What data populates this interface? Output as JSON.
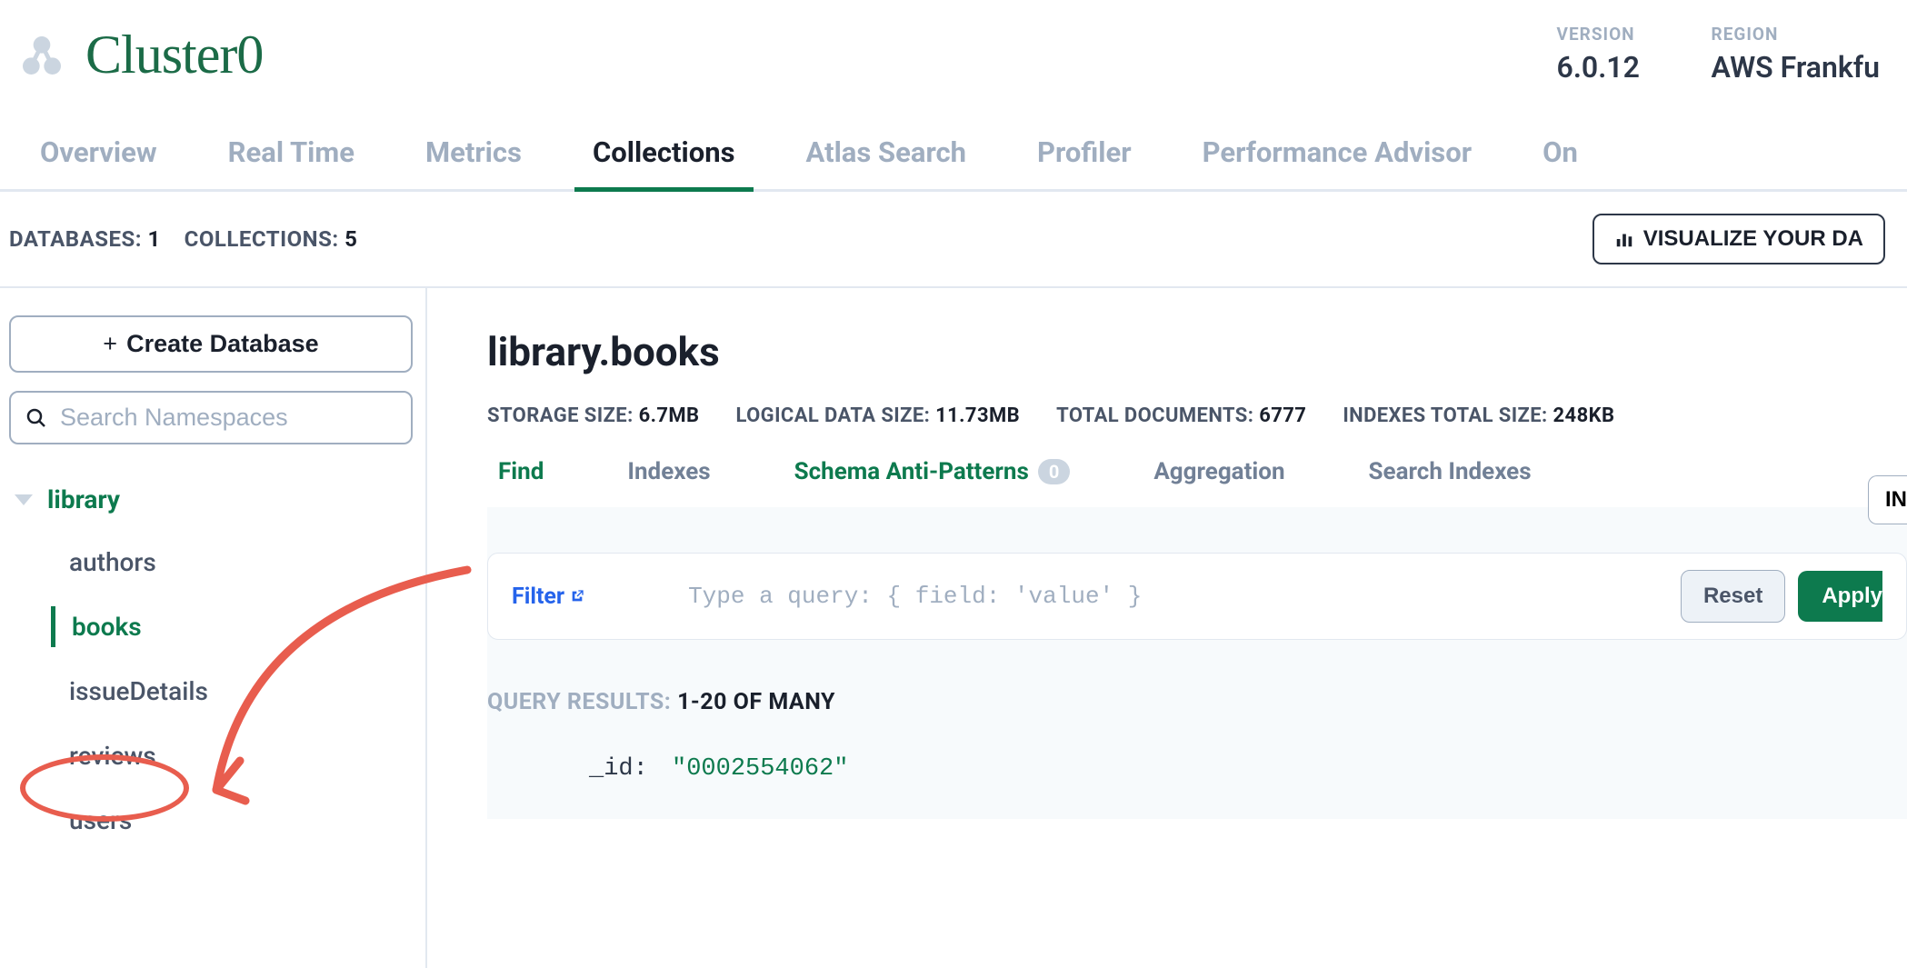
{
  "cluster": {
    "name": "Cluster0"
  },
  "meta": {
    "versionLabel": "VERSION",
    "versionValue": "6.0.12",
    "regionLabel": "REGION",
    "regionValue": "AWS Frankfu"
  },
  "tabs": [
    "Overview",
    "Real Time",
    "Metrics",
    "Collections",
    "Atlas Search",
    "Profiler",
    "Performance Advisor",
    "On"
  ],
  "activeTabIndex": 3,
  "statsbar": {
    "databasesLabel": "DATABASES:",
    "databasesCount": "1",
    "collectionsLabel": "COLLECTIONS:",
    "collectionsCount": "5",
    "visualizeLabel": "VISUALIZE YOUR DA"
  },
  "sidebar": {
    "createLabel": "Create Database",
    "searchPlaceholder": "Search Namespaces",
    "database": "library",
    "collections": [
      "authors",
      "books",
      "issueDetails",
      "reviews",
      "users"
    ],
    "selectedIndex": 1
  },
  "main": {
    "namespace": "library.books",
    "stats": {
      "storageLabel": "STORAGE SIZE:",
      "storageValue": "6.7MB",
      "logicalLabel": "LOGICAL DATA SIZE:",
      "logicalValue": "11.73MB",
      "docsLabel": "TOTAL DOCUMENTS:",
      "docsValue": "6777",
      "idxLabel": "INDEXES TOTAL SIZE:",
      "idxValue": "248KB"
    },
    "subtabs": {
      "find": "Find",
      "indexes": "Indexes",
      "schema": "Schema Anti-Patterns",
      "schemaBadge": "0",
      "aggregation": "Aggregation",
      "searchIndexes": "Search Indexes"
    },
    "insertLabel": "IN",
    "filterLabel": "Filter",
    "filterPlaceholder": "Type a query: { field: 'value' }",
    "resetLabel": "Reset",
    "applyLabel": "Apply",
    "queryResultsLabel": "QUERY RESULTS:",
    "queryResultsRange": "1-20 OF MANY",
    "doc": {
      "key": "_id",
      "value": "\"0002554062\""
    }
  }
}
